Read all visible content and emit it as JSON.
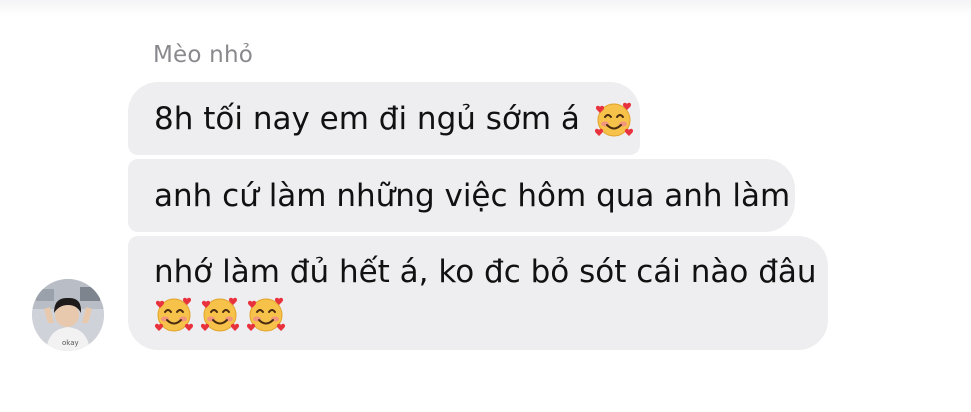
{
  "conversation": {
    "sender_name": "Mèo nhỏ",
    "messages": [
      {
        "text": "8h tối nay em đi ngủ sớm á",
        "emojis": [
          "smiling-face-with-hearts"
        ]
      },
      {
        "text": "anh cứ làm những việc hôm qua anh làm",
        "emojis": []
      },
      {
        "text": "nhớ làm đủ hết á, ko đc bỏ sót cái nào đâu",
        "emojis": [
          "smiling-face-with-hearts",
          "smiling-face-with-hearts",
          "smiling-face-with-hearts"
        ]
      }
    ]
  },
  "avatar": {
    "icon": "user-avatar-photo"
  },
  "colors": {
    "bubble_background": "#eeeef0",
    "sender_name": "#8a8a8e",
    "message_text": "#111111",
    "emoji_face": "#f7c24a",
    "emoji_heart": "#e8333f"
  }
}
